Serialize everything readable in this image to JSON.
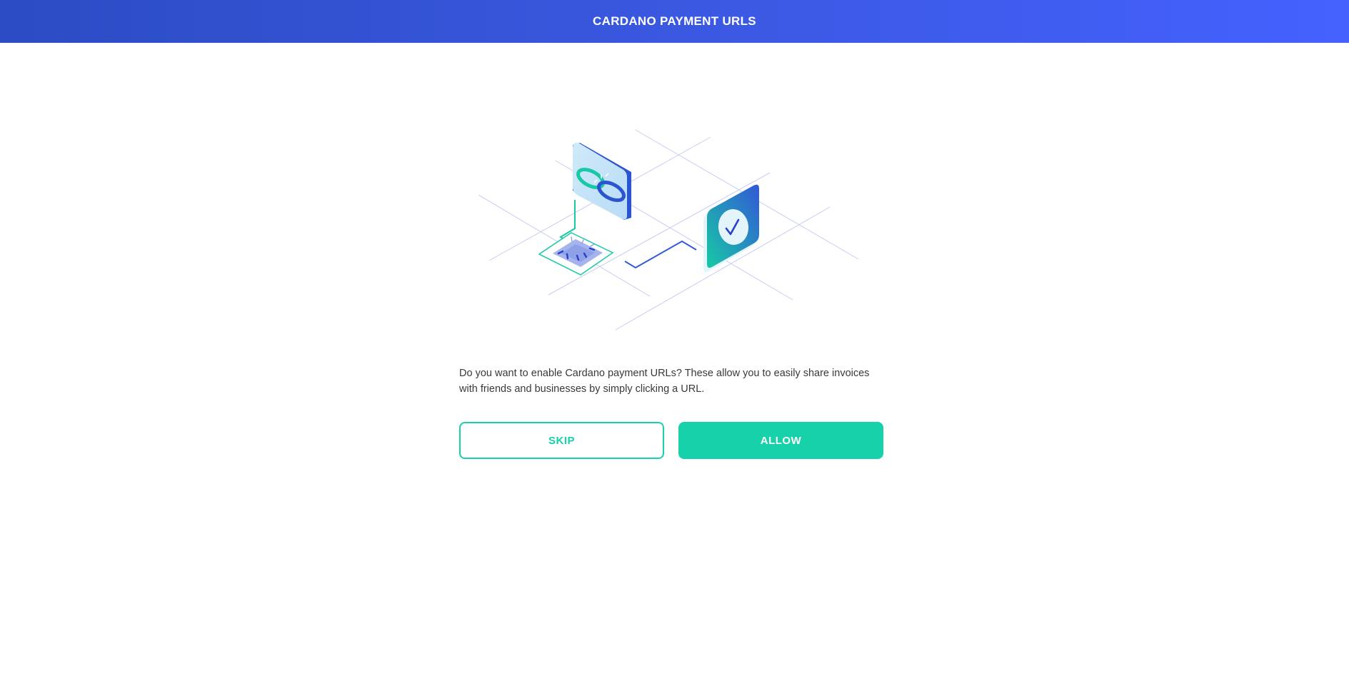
{
  "header": {
    "title": "CARDANO PAYMENT URLS"
  },
  "main": {
    "message": "Do you want to enable Cardano payment URLs? These allow you to easily share invoices with friends and businesses by simply clicking a URL.",
    "skip_label": "SKIP",
    "allow_label": "ALLOW"
  },
  "colors": {
    "header_gradient_start": "#2b4cc4",
    "header_gradient_end": "#4561ff",
    "accent": "#17d1aa",
    "text": "#38393d"
  },
  "icons": [
    "link-icon",
    "checkmark-icon",
    "chip-icon"
  ]
}
